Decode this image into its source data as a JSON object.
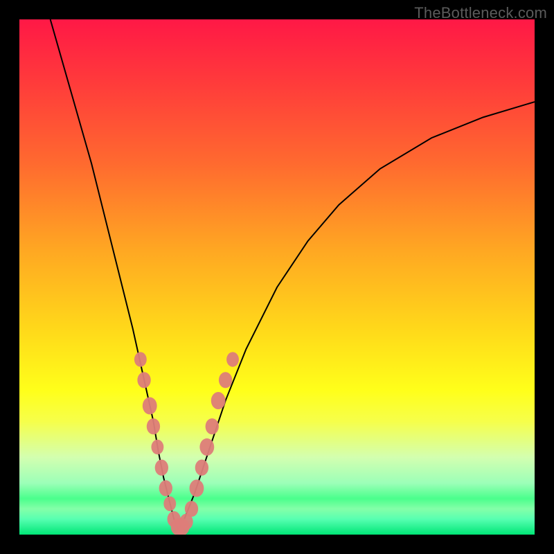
{
  "watermark": "TheBottleneck.com",
  "chart_data": {
    "type": "line",
    "title": "",
    "xlabel": "",
    "ylabel": "",
    "xlim": [
      0,
      100
    ],
    "ylim": [
      0,
      100
    ],
    "grid": false,
    "legend": false,
    "background_gradient": {
      "top": "#ff1846",
      "mid_upper": "#ffa822",
      "mid": "#ffff1a",
      "mid_lower": "#9cffb8",
      "bottom": "#00e676"
    },
    "series": [
      {
        "name": "left-branch",
        "x": [
          6,
          10,
          14,
          18,
          20,
          22,
          24,
          26,
          27,
          28,
          29,
          30,
          30.8
        ],
        "y": [
          100,
          86,
          72,
          56,
          48,
          40,
          31,
          22,
          16,
          11,
          7,
          3,
          1
        ]
      },
      {
        "name": "right-branch",
        "x": [
          30.8,
          32,
          34,
          36,
          38,
          40,
          44,
          50,
          56,
          62,
          70,
          80,
          90,
          100
        ],
        "y": [
          1,
          3,
          8,
          14,
          20,
          26,
          36,
          48,
          57,
          64,
          71,
          77,
          81,
          84
        ]
      }
    ],
    "markers": [
      {
        "x": 23.5,
        "y": 34,
        "r": 1.2
      },
      {
        "x": 24.2,
        "y": 30,
        "r": 1.3
      },
      {
        "x": 25.3,
        "y": 25,
        "r": 1.4
      },
      {
        "x": 26.0,
        "y": 21,
        "r": 1.3
      },
      {
        "x": 26.8,
        "y": 17,
        "r": 1.2
      },
      {
        "x": 27.6,
        "y": 13,
        "r": 1.3
      },
      {
        "x": 28.4,
        "y": 9,
        "r": 1.3
      },
      {
        "x": 29.2,
        "y": 6,
        "r": 1.2
      },
      {
        "x": 30.0,
        "y": 3,
        "r": 1.3
      },
      {
        "x": 30.8,
        "y": 1.5,
        "r": 1.4
      },
      {
        "x": 31.6,
        "y": 1.5,
        "r": 1.4
      },
      {
        "x": 32.4,
        "y": 2.5,
        "r": 1.3
      },
      {
        "x": 33.4,
        "y": 5,
        "r": 1.3
      },
      {
        "x": 34.4,
        "y": 9,
        "r": 1.4
      },
      {
        "x": 35.4,
        "y": 13,
        "r": 1.3
      },
      {
        "x": 36.4,
        "y": 17,
        "r": 1.4
      },
      {
        "x": 37.4,
        "y": 21,
        "r": 1.3
      },
      {
        "x": 38.6,
        "y": 26,
        "r": 1.4
      },
      {
        "x": 40.0,
        "y": 30,
        "r": 1.3
      },
      {
        "x": 41.4,
        "y": 34,
        "r": 1.2
      }
    ]
  }
}
